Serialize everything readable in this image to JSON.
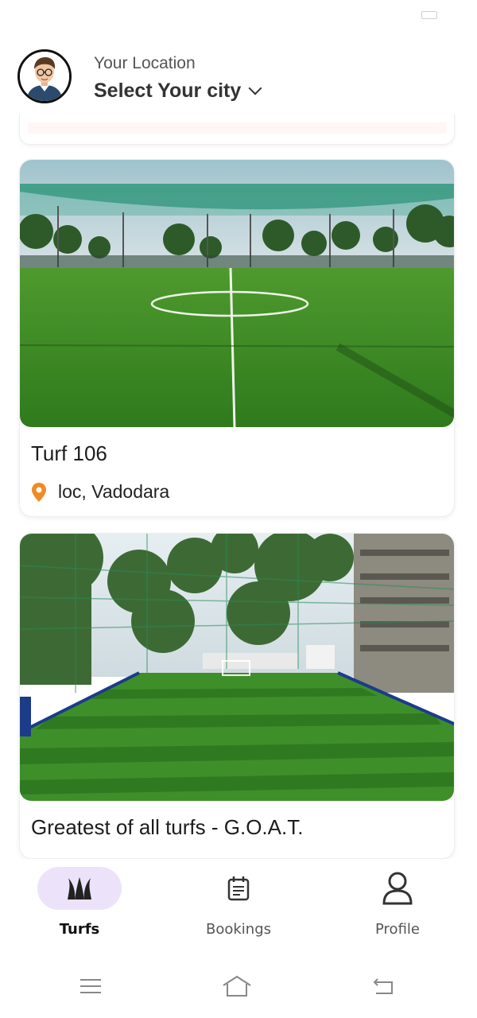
{
  "header": {
    "location_label": "Your Location",
    "select_city": "Select Your city"
  },
  "turfs": [
    {
      "name": "Turf 106",
      "location": "loc, Vadodara"
    },
    {
      "name": "Greatest of all turfs - G.O.A.T."
    }
  ],
  "nav": {
    "items": [
      {
        "label": "Turfs",
        "icon": "grass-icon",
        "active": true
      },
      {
        "label": "Bookings",
        "icon": "calendar-icon",
        "active": false
      },
      {
        "label": "Profile",
        "icon": "person-icon",
        "active": false
      }
    ]
  },
  "colors": {
    "accent": "#ece3fa",
    "pin": "#f08a24",
    "turf_green": "#3f8f26"
  }
}
